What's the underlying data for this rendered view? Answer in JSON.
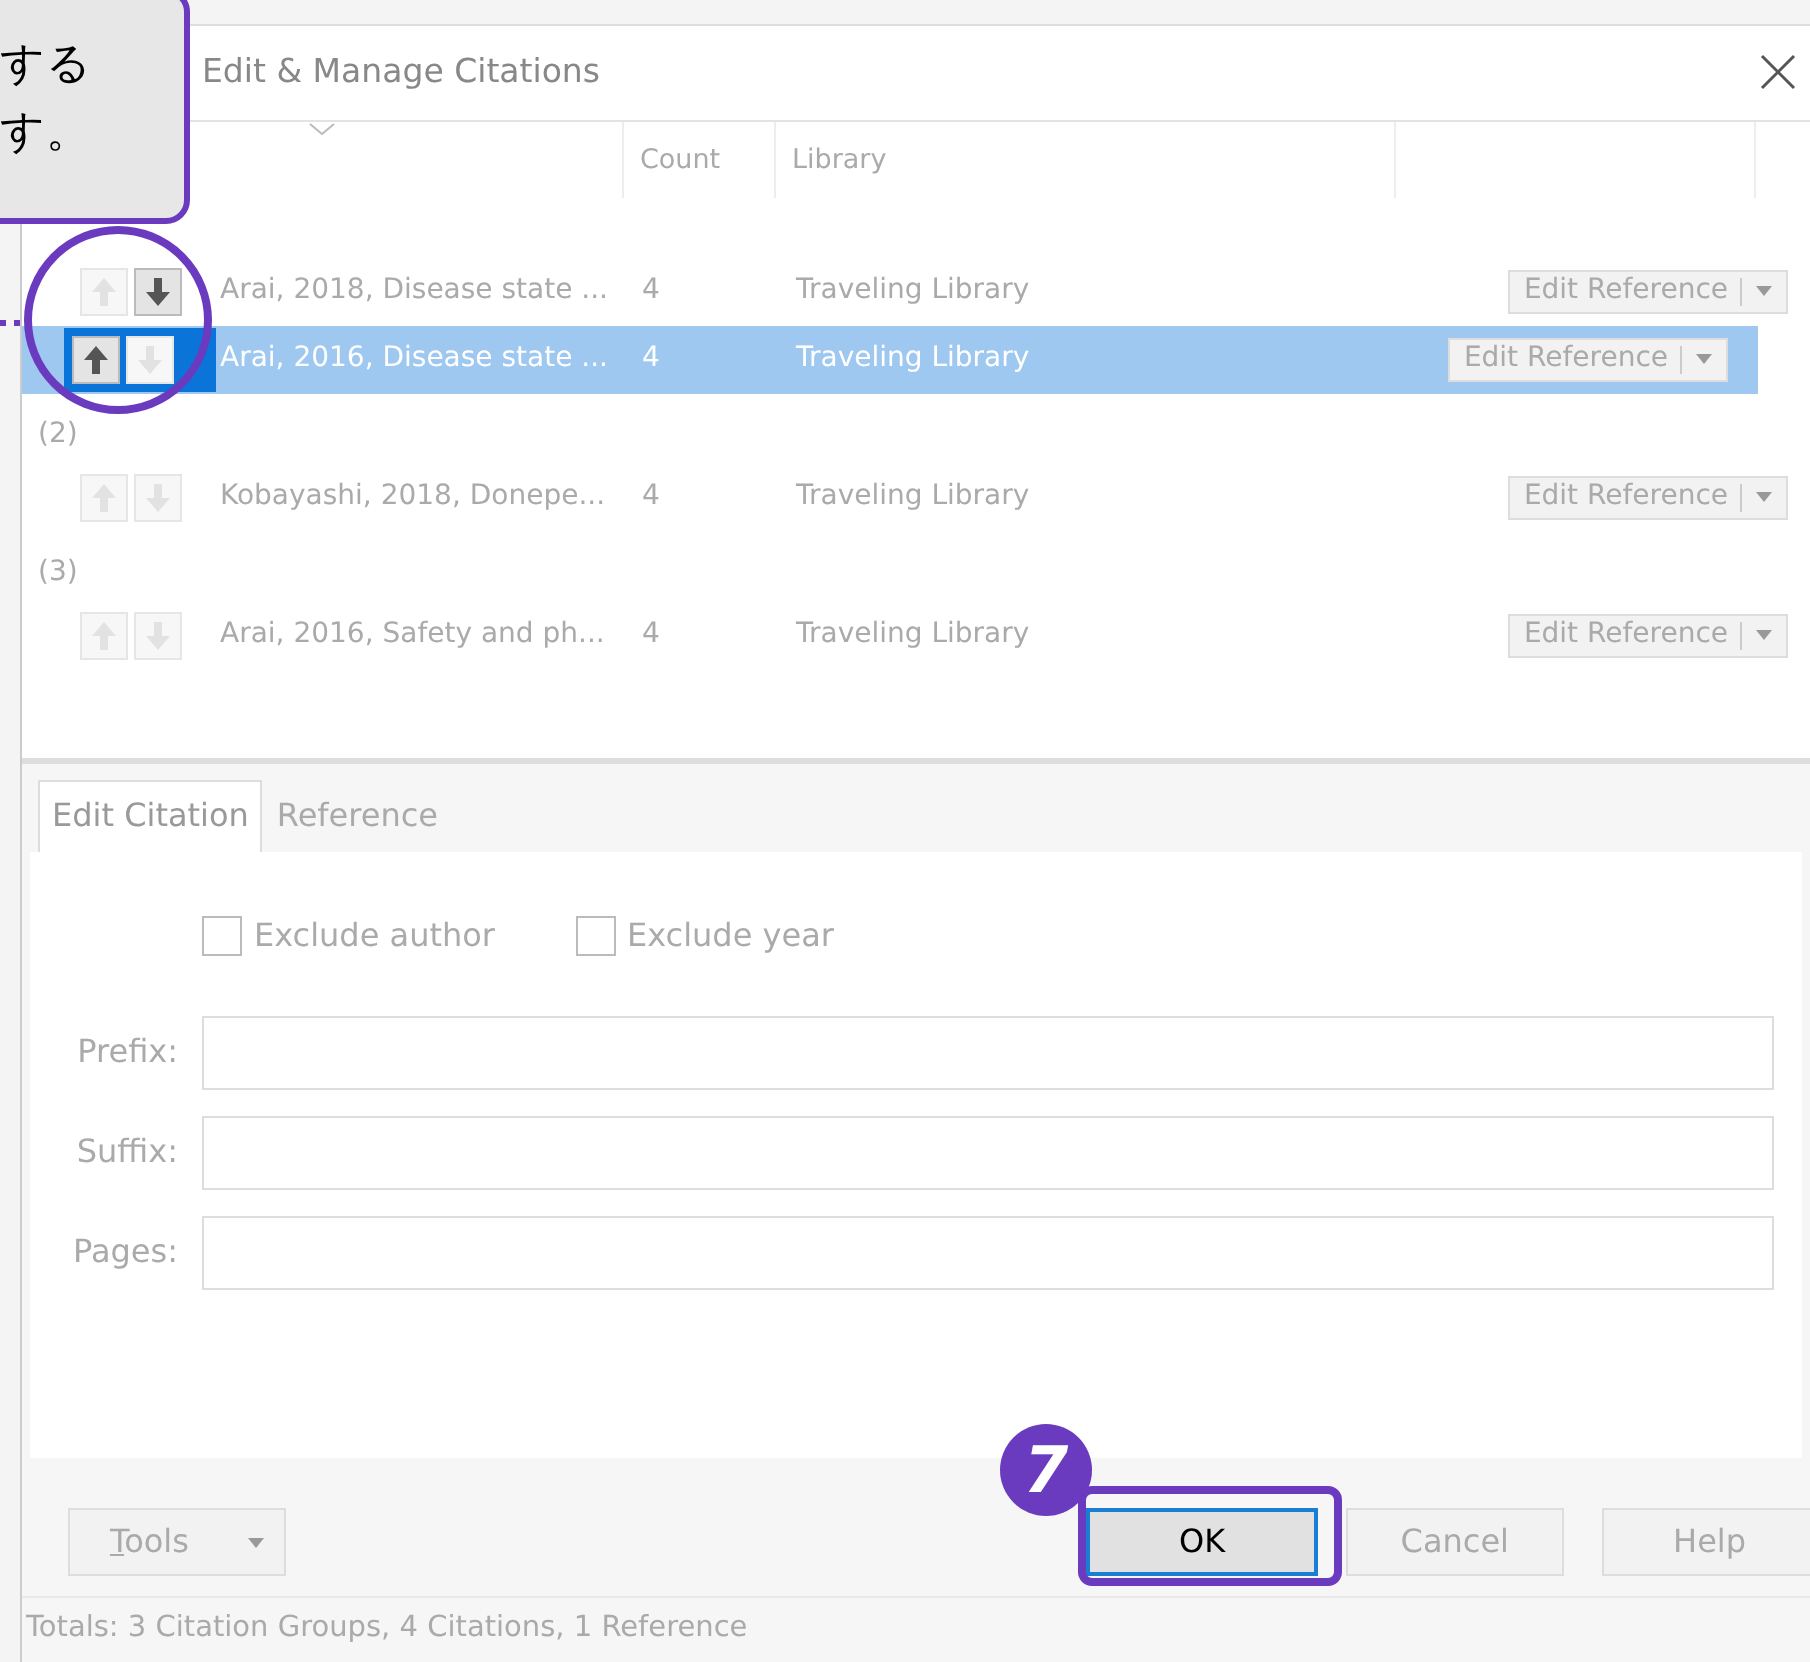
{
  "callout": {
    "lines": [
      "する",
      "す。"
    ]
  },
  "dialog": {
    "title": "Edit & Manage Citations"
  },
  "columns": {
    "count": "Count",
    "library": "Library"
  },
  "groups": [
    {
      "citations": [
        {
          "text": "Arai, 2018, Disease state ...",
          "count": "4",
          "library": "Traveling Library",
          "up_enabled": false,
          "down_enabled": true,
          "selected": false,
          "button": "Edit Reference"
        },
        {
          "text": "Arai, 2016, Disease state ...",
          "count": "4",
          "library": "Traveling Library",
          "up_enabled": true,
          "down_enabled": false,
          "selected": true,
          "button": "Edit Reference"
        }
      ]
    },
    {
      "label": "(2)",
      "citations": [
        {
          "text": "Kobayashi, 2018, Donepe...",
          "count": "4",
          "library": "Traveling Library",
          "up_enabled": false,
          "down_enabled": false,
          "selected": false,
          "button": "Edit Reference"
        }
      ]
    },
    {
      "label": "(3)",
      "citations": [
        {
          "text": "Arai, 2016, Safety and ph...",
          "count": "4",
          "library": "Traveling Library",
          "up_enabled": false,
          "down_enabled": false,
          "selected": false,
          "button": "Edit Reference"
        }
      ]
    }
  ],
  "tabs": [
    {
      "label": "Edit Citation",
      "selected": true
    },
    {
      "label": "Reference",
      "selected": false
    }
  ],
  "checkboxes": [
    {
      "label": "Exclude author",
      "checked": false
    },
    {
      "label": "Exclude year",
      "checked": false
    }
  ],
  "fields": [
    {
      "label": "Prefix:"
    },
    {
      "label": "Suffix:"
    },
    {
      "label": "Pages:"
    }
  ],
  "buttons": {
    "tools": "Tools",
    "ok": "OK",
    "cancel": "Cancel",
    "help": "Help"
  },
  "step_badge": "7",
  "status_bar": "Totals: 3 Citation Groups, 4 Citations, 1 Reference"
}
